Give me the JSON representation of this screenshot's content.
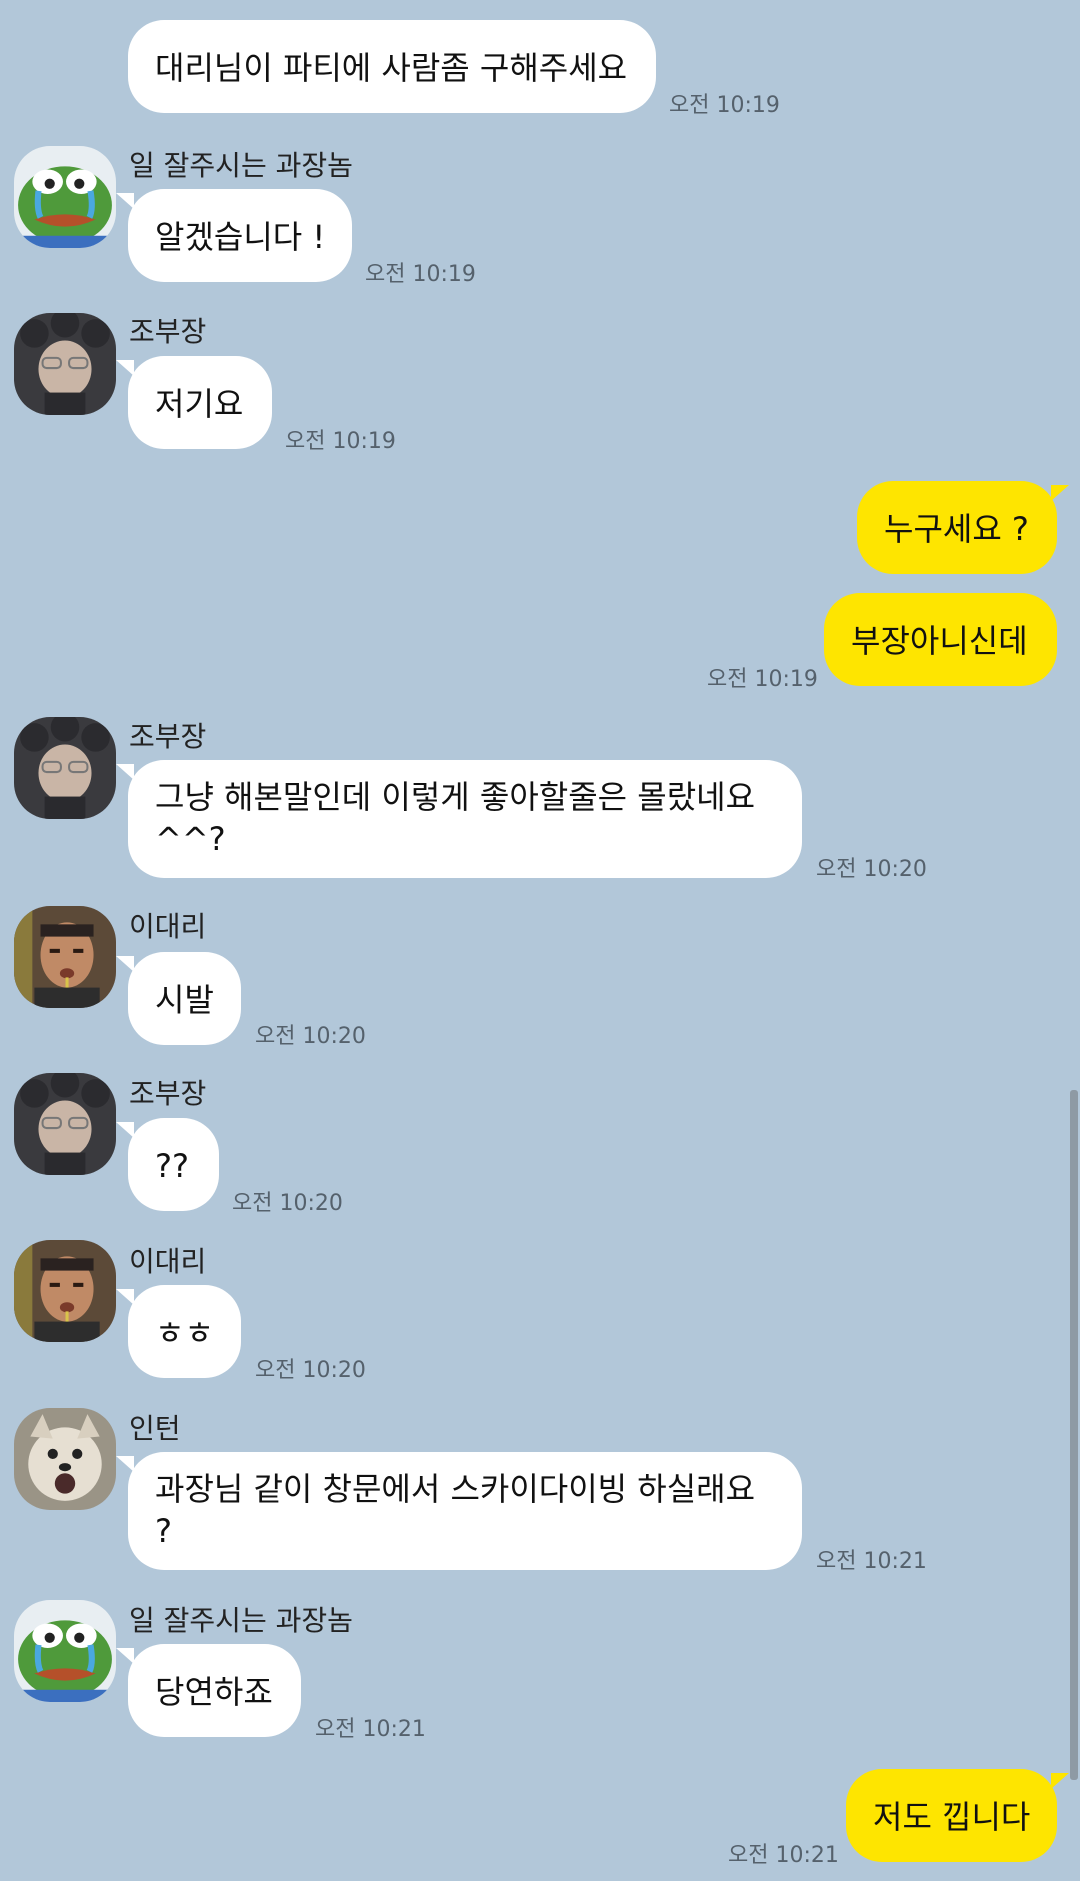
{
  "messages": [
    {
      "text": "대리님이 파티에 사람좀 구해주세요",
      "time": "오전 10:19"
    },
    {
      "name": "일 잘주시는 과장놈",
      "text": "알겠습니다 !",
      "time": "오전 10:19",
      "avatar": "pepe-frog-crying-icon"
    },
    {
      "name": "조부장",
      "text": "저기요",
      "time": "오전 10:19",
      "avatar": "hooded-person-icon"
    },
    {
      "text": "누구세요 ?"
    },
    {
      "text": "부장아니신데",
      "time": "오전 10:19"
    },
    {
      "name": "조부장",
      "text": "그냥 해본말인데 이렇게 좋아할줄은 몰랐네요 ^^?",
      "time": "오전 10:20",
      "avatar": "hooded-person-icon"
    },
    {
      "name": "이대리",
      "text": "시발",
      "time": "오전 10:20",
      "avatar": "man-portrait-icon"
    },
    {
      "name": "조부장",
      "text": "??",
      "time": "오전 10:20",
      "avatar": "hooded-person-icon"
    },
    {
      "name": "이대리",
      "text": "ㅎㅎ",
      "time": "오전 10:20",
      "avatar": "man-portrait-icon"
    },
    {
      "name": "인턴",
      "text": "과장님 같이 창문에서 스카이다이빙 하실래요 ?",
      "time": "오전 10:21",
      "avatar": "shocked-dog-icon"
    },
    {
      "name": "일 잘주시는 과장놈",
      "text": "당연하죠",
      "time": "오전 10:21",
      "avatar": "pepe-frog-crying-icon"
    },
    {
      "text": "저도 낍니다",
      "time": "오전 10:21"
    }
  ],
  "colors": {
    "background": "#b2c7d9",
    "incoming_bubble": "#ffffff",
    "outgoing_bubble": "#fee500"
  }
}
